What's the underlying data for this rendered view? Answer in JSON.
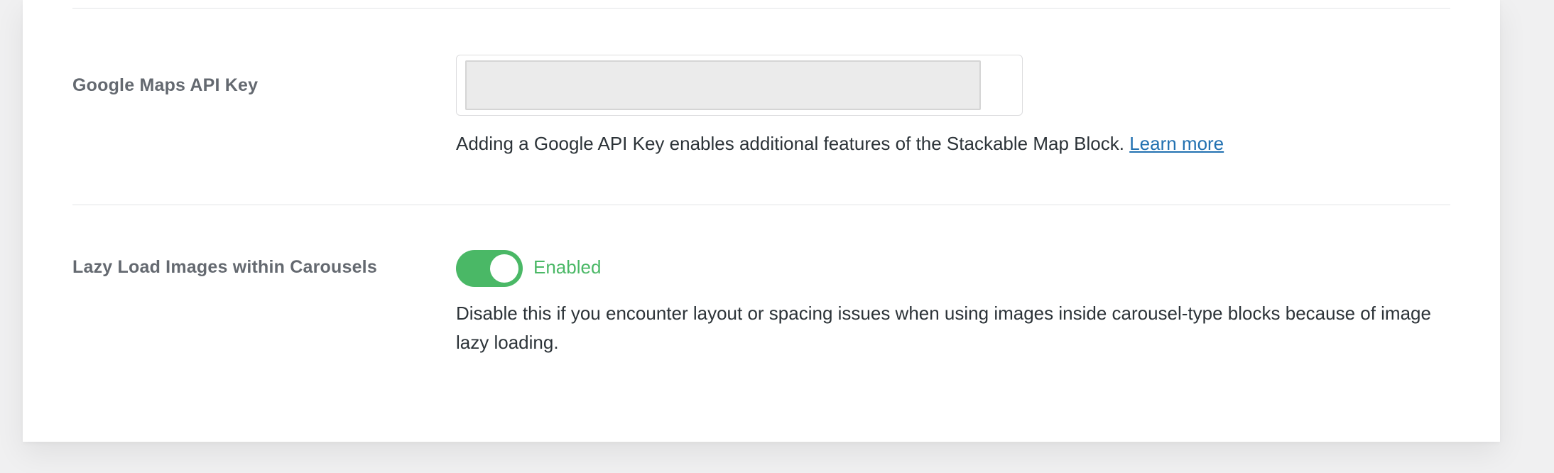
{
  "settings": {
    "google_maps": {
      "label": "Google Maps API Key",
      "input_value": "",
      "description": "Adding a Google API Key enables additional features of the Stackable Map Block.",
      "link_text": "Learn more"
    },
    "lazy_load": {
      "label": "Lazy Load Images within Carousels",
      "enabled": true,
      "status_text": "Enabled",
      "description": "Disable this if you encounter layout or spacing issues when using images inside carousel-type blocks because of image lazy loading."
    }
  },
  "colors": {
    "toggle_on": "#4ab866",
    "link": "#2271b1",
    "label": "#646970",
    "text": "#2c3338"
  }
}
